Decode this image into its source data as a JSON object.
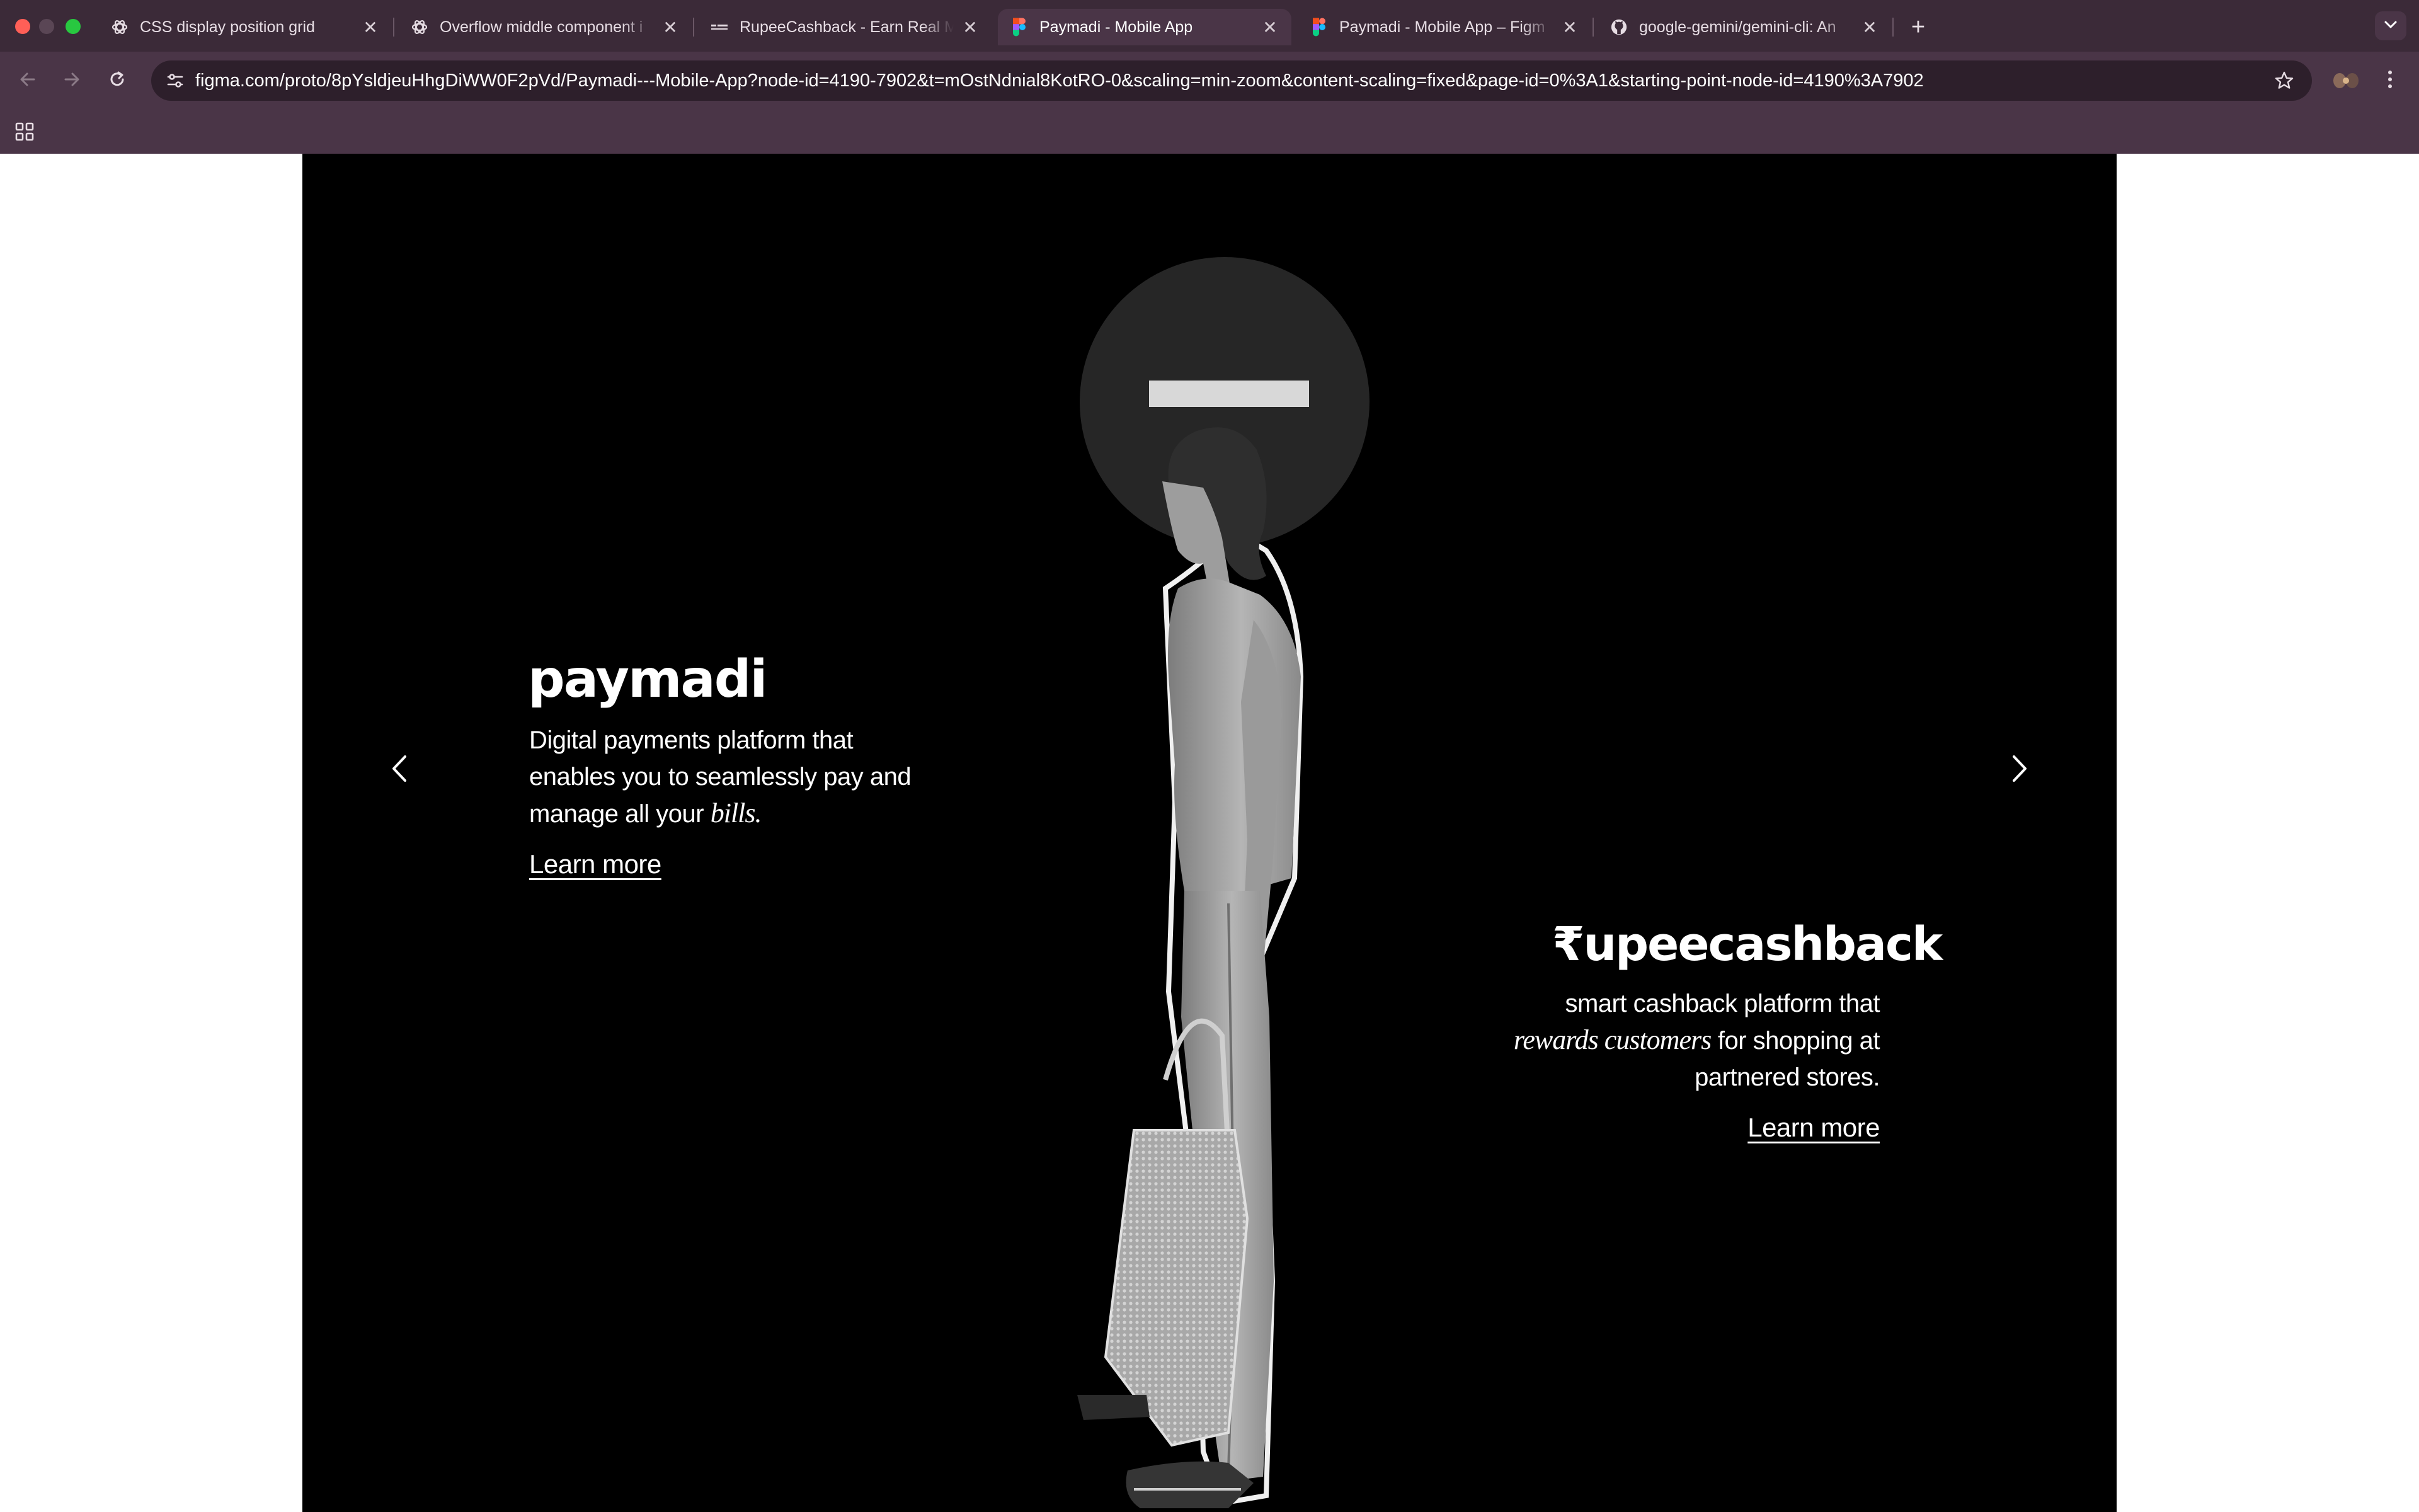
{
  "browser": {
    "tabs": [
      {
        "title": "CSS display position grid",
        "icon": "openai-icon",
        "active": false
      },
      {
        "title": "Overflow middle component i",
        "icon": "openai-icon",
        "active": false
      },
      {
        "title": "RupeeCashback - Earn Real M",
        "icon": "rupeecashback-icon",
        "active": false
      },
      {
        "title": "Paymadi - Mobile App",
        "icon": "figma-icon",
        "active": true
      },
      {
        "title": "Paymadi - Mobile App – Figm",
        "icon": "figma-icon",
        "active": false
      },
      {
        "title": "google-gemini/gemini-cli: An",
        "icon": "github-icon",
        "active": false
      }
    ],
    "close_glyph": "✕",
    "new_tab_glyph": "+",
    "url": "figma.com/proto/8pYsldjeuHhgDiWW0F2pVd/Paymadi---Mobile-App?node-id=4190-7902&t=mOstNdnial8KotRO-0&scaling=min-zoom&content-scaling=fixed&page-id=0%3A1&starting-point-node-id=4190%3A7902"
  },
  "slide": {
    "left": {
      "brand": "paymadi",
      "desc_line1": "Digital payments platform that",
      "desc_line2": "enables you to seamlessly pay and",
      "desc_line3_pre": "manage all your ",
      "desc_line3_em": "bills.",
      "link": "Learn more"
    },
    "right": {
      "brand": "₹upeecashback",
      "desc_line1": "smart cashback platform that",
      "desc_line2_em": "rewards customers",
      "desc_line2_post": " for shopping at",
      "desc_line3": "partnered stores.",
      "link": "Learn more"
    },
    "prev_glyph": "‹",
    "next_glyph": "›"
  },
  "colors": {
    "chrome_tabbar": "#3b2a38",
    "chrome_toolbar": "#4a3547",
    "slide_background": "#000000",
    "text": "#ffffff"
  }
}
